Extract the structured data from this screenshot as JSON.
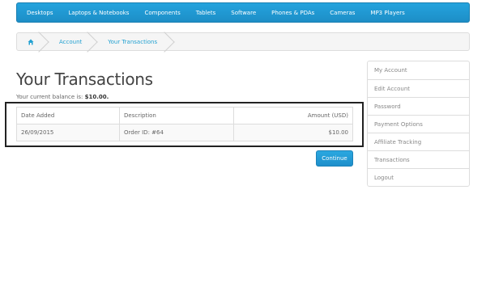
{
  "menu": {
    "items": [
      "Desktops",
      "Laptops & Notebooks",
      "Components",
      "Tablets",
      "Software",
      "Phones & PDAs",
      "Cameras",
      "MP3 Players"
    ]
  },
  "breadcrumb": {
    "home_icon": "home-icon",
    "items": [
      "Account",
      "Your Transactions"
    ]
  },
  "page": {
    "title": "Your Transactions",
    "balance_label": "Your current balance is:",
    "balance_value": "$10.00."
  },
  "table": {
    "headers": [
      "Date Added",
      "Description",
      "Amount (USD)"
    ],
    "rows": [
      [
        "26/09/2015",
        "Order ID: #64",
        "$10.00"
      ]
    ]
  },
  "actions": {
    "continue_label": "Continue"
  },
  "sidebar": {
    "items": [
      "My Account",
      "Edit Account",
      "Password",
      "Payment Options",
      "Affiliate Tracking",
      "Transactions",
      "Logout"
    ]
  },
  "colors": {
    "accent": "#23a1d1",
    "menu_bg": "#1d8ec6"
  }
}
